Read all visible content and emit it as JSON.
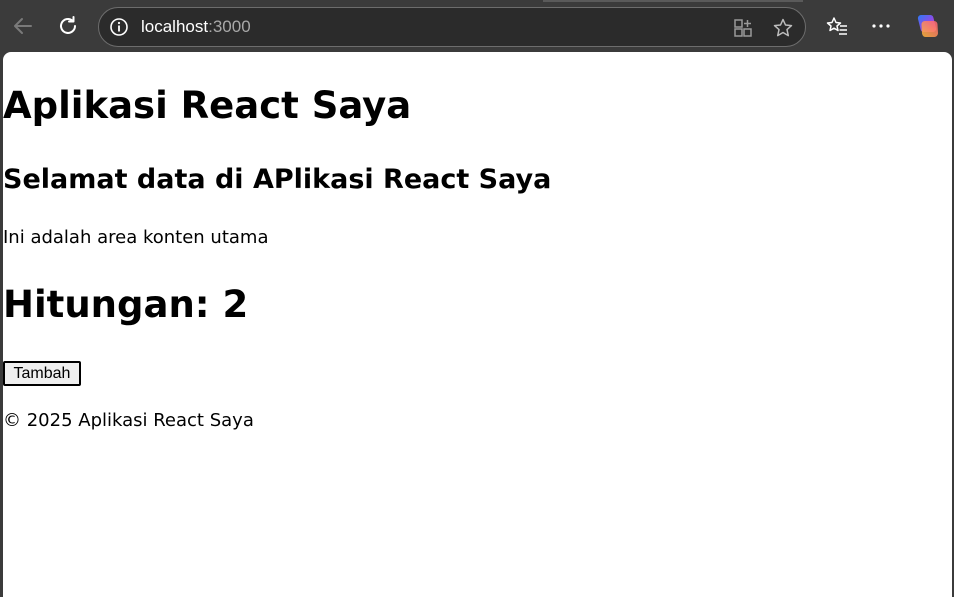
{
  "browser": {
    "url_host": "localhost",
    "url_port": ":3000",
    "icons": [
      "back-arrow-icon",
      "reload-icon",
      "info-icon",
      "app-grid-icon",
      "star-icon",
      "favorites-icon",
      "more-icon",
      "copilot-icon"
    ]
  },
  "page": {
    "title": "Aplikasi React Saya",
    "welcome": "Selamat data di APlikasi React Saya",
    "content": "Ini adalah area konten utama",
    "counter_text": "Hitungan: 2",
    "button_label": "Tambah",
    "footer": "© 2025 Aplikasi React Saya"
  }
}
